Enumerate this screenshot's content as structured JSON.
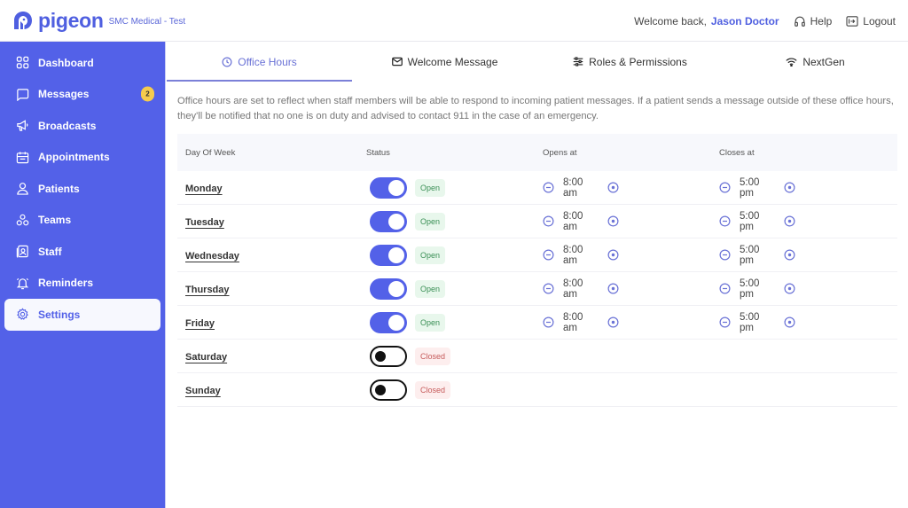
{
  "header": {
    "logo_text": "pigeon",
    "org_name": "SMC Medical - Test",
    "welcome_text": "Welcome back,",
    "username": "Jason Doctor",
    "help_label": "Help",
    "logout_label": "Logout"
  },
  "sidebar": {
    "items": [
      {
        "label": "Dashboard",
        "icon": "grid-icon"
      },
      {
        "label": "Messages",
        "icon": "chat-icon",
        "badge": "2"
      },
      {
        "label": "Broadcasts",
        "icon": "megaphone-icon"
      },
      {
        "label": "Appointments",
        "icon": "calendar-icon"
      },
      {
        "label": "Patients",
        "icon": "person-icon"
      },
      {
        "label": "Teams",
        "icon": "teams-icon"
      },
      {
        "label": "Staff",
        "icon": "staff-badge-icon"
      },
      {
        "label": "Reminders",
        "icon": "bell-icon"
      },
      {
        "label": "Settings",
        "icon": "gear-icon",
        "active": true
      }
    ]
  },
  "tabs": [
    {
      "label": "Office Hours",
      "icon": "clock-icon",
      "active": true
    },
    {
      "label": "Welcome Message",
      "icon": "envelope-icon"
    },
    {
      "label": "Roles & Permissions",
      "icon": "sliders-icon"
    },
    {
      "label": "NextGen",
      "icon": "wifi-icon"
    }
  ],
  "description": "Office hours are set to reflect when staff members will be able to respond to incoming patient messages. If a patient sends a message outside of these office hours, they'll be notified that no one is on duty and advised to contact 911 in the case of an emergency.",
  "table": {
    "columns": [
      "Day Of Week",
      "Status",
      "Opens at",
      "Closes at"
    ],
    "rows": [
      {
        "day": "Monday",
        "enabled": true,
        "status": "Open",
        "opens": "8:00 am",
        "closes": "5:00 pm"
      },
      {
        "day": "Tuesday",
        "enabled": true,
        "status": "Open",
        "opens": "8:00 am",
        "closes": "5:00 pm"
      },
      {
        "day": "Wednesday",
        "enabled": true,
        "status": "Open",
        "opens": "8:00 am",
        "closes": "5:00 pm"
      },
      {
        "day": "Thursday",
        "enabled": true,
        "status": "Open",
        "opens": "8:00 am",
        "closes": "5:00 pm"
      },
      {
        "day": "Friday",
        "enabled": true,
        "status": "Open",
        "opens": "8:00 am",
        "closes": "5:00 pm"
      },
      {
        "day": "Saturday",
        "enabled": false,
        "status": "Closed"
      },
      {
        "day": "Sunday",
        "enabled": false,
        "status": "Closed"
      }
    ]
  },
  "colors": {
    "brand": "#5361e8",
    "open_text": "#3a8f55",
    "open_bg": "#e8f7ec",
    "closed_text": "#c65b5b",
    "closed_bg": "#fdeeee",
    "badge": "#f5cb4d"
  }
}
